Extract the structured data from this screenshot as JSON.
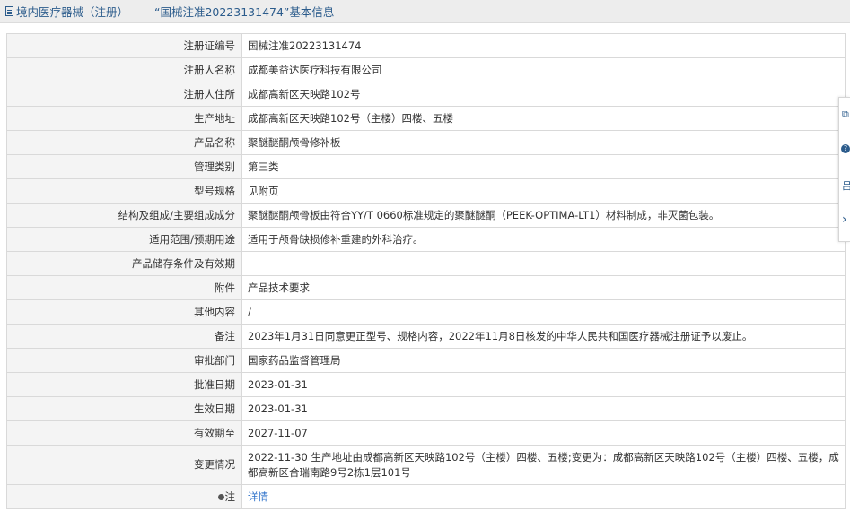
{
  "header": {
    "title": "境内医疗器械（注册） ——“国械注准20223131474”基本信息"
  },
  "rows": [
    {
      "label": "注册证编号",
      "value": "国械注准20223131474"
    },
    {
      "label": "注册人名称",
      "value": "成都美益达医疗科技有限公司"
    },
    {
      "label": "注册人住所",
      "value": "成都高新区天映路102号"
    },
    {
      "label": "生产地址",
      "value": "成都高新区天映路102号（主楼）四楼、五楼"
    },
    {
      "label": "产品名称",
      "value": "聚醚醚酮颅骨修补板"
    },
    {
      "label": "管理类别",
      "value": "第三类"
    },
    {
      "label": "型号规格",
      "value": "见附页"
    },
    {
      "label": "结构及组成/主要组成成分",
      "value": "聚醚醚酮颅骨板由符合YY/T 0660标准规定的聚醚醚酮（PEEK-OPTIMA-LT1）材料制成，非灭菌包装。"
    },
    {
      "label": "适用范围/预期用途",
      "value": "适用于颅骨缺损修补重建的外科治疗。"
    },
    {
      "label": "产品储存条件及有效期",
      "value": ""
    },
    {
      "label": "附件",
      "value": "产品技术要求"
    },
    {
      "label": "其他内容",
      "value": "/"
    },
    {
      "label": "备注",
      "value": "2023年1月31日同意更正型号、规格内容，2022年11月8日核发的中华人民共和国医疗器械注册证予以废止。"
    },
    {
      "label": "审批部门",
      "value": "国家药品监督管理局"
    },
    {
      "label": "批准日期",
      "value": "2023-01-31"
    },
    {
      "label": "生效日期",
      "value": "2023-01-31"
    },
    {
      "label": "有效期至",
      "value": "2027-11-07"
    },
    {
      "label": "变更情况",
      "value": "2022-11-30 生产地址由成都高新区天映路102号（主楼）四楼、五楼;变更为：成都高新区天映路102号（主楼）四楼、五楼，成都高新区合瑞南路9号2栋1层101号"
    }
  ],
  "note": {
    "label": "注",
    "link": "详情",
    "icon": "pin-icon"
  },
  "side_panel": {
    "icons": [
      "share-icon",
      "help-icon",
      "qrcode-icon",
      "collapse-arrow-icon"
    ],
    "glyphs": [
      "⧉",
      "?",
      "吕",
      "›"
    ]
  }
}
